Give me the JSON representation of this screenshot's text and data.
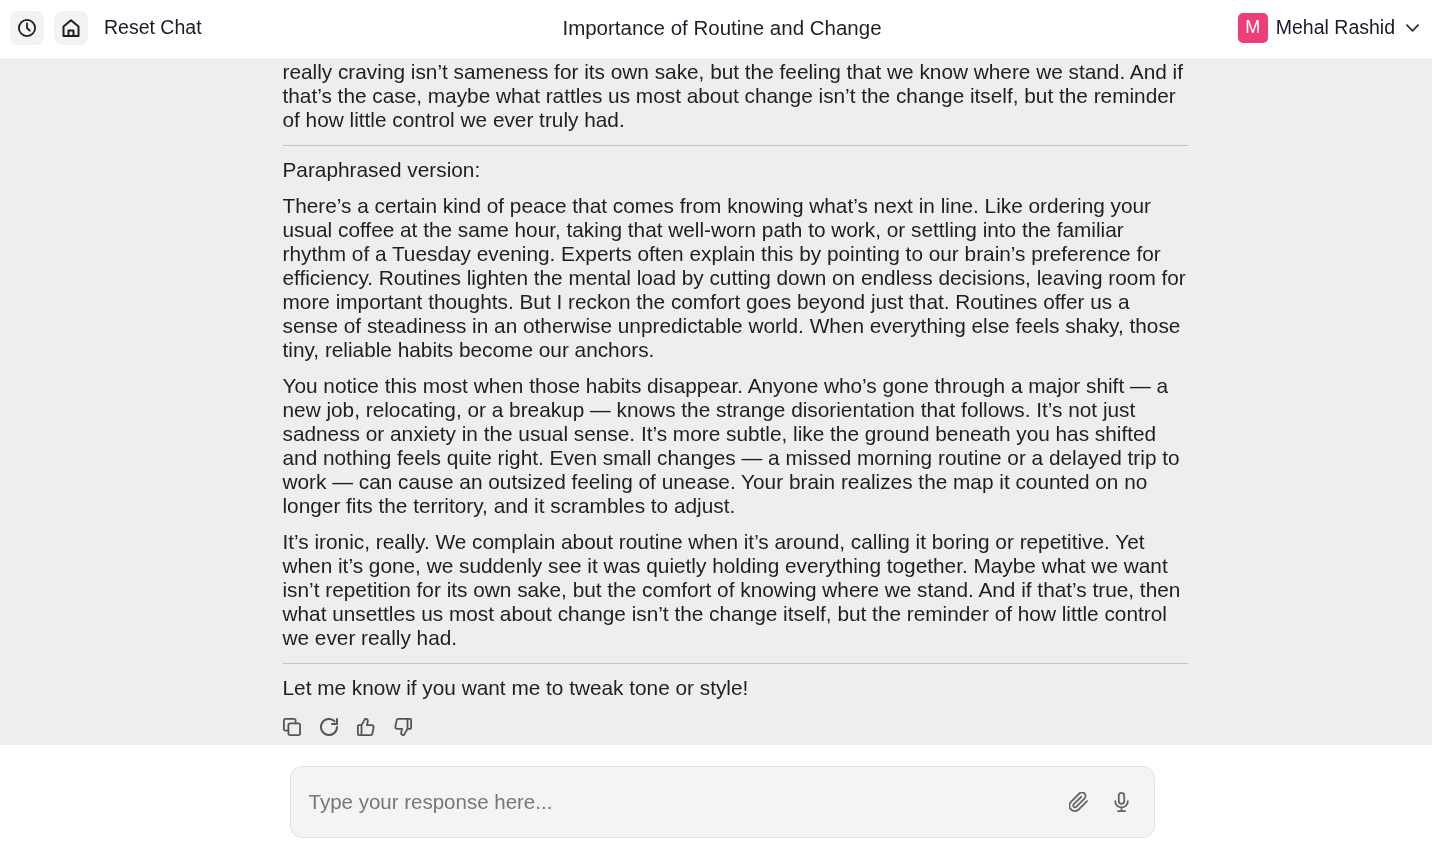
{
  "header": {
    "reset_label": "Reset Chat",
    "title": "Importance of Routine and Change",
    "user": {
      "initial": "M",
      "name": "Mehal Rashid"
    }
  },
  "message": {
    "blocks": [
      {
        "kind": "paragraph",
        "text": "really craving isn’t sameness for its own sake, but the feeling that we know where we stand. And if that’s the case, maybe what rattles us most about change isn’t the change itself, but the reminder of how little control we ever truly had."
      },
      {
        "kind": "divider"
      },
      {
        "kind": "paragraph",
        "text": "Paraphrased version:"
      },
      {
        "kind": "paragraph",
        "text": "There’s a certain kind of peace that comes from knowing what’s next in line. Like ordering your usual coffee at the same hour, taking that well-worn path to work, or settling into the familiar rhythm of a Tuesday evening. Experts often explain this by pointing to our brain’s preference for efficiency. Routines lighten the mental load by cutting down on endless decisions, leaving room for more important thoughts. But I reckon the comfort goes beyond just that. Routines offer us a sense of steadiness in an otherwise unpredictable world. When everything else feels shaky, those tiny, reliable habits become our anchors."
      },
      {
        "kind": "paragraph",
        "text": "You notice this most when those habits disappear. Anyone who’s gone through a major shift — a new job, relocating, or a breakup — knows the strange disorientation that follows. It’s not just sadness or anxiety in the usual sense. It’s more subtle, like the ground beneath you has shifted and nothing feels quite right. Even small changes — a missed morning routine or a delayed trip to work — can cause an outsized feeling of unease. Your brain realizes the map it counted on no longer fits the territory, and it scrambles to adjust."
      },
      {
        "kind": "paragraph",
        "text": "It’s ironic, really. We complain about routine when it’s around, calling it boring or repetitive. Yet when it’s gone, we suddenly see it was quietly holding everything together. Maybe what we want isn’t repetition for its own sake, but the comfort of knowing where we stand. And if that’s true, then what unsettles us most about change isn’t the change itself, but the reminder of how little control we ever really had."
      },
      {
        "kind": "divider"
      },
      {
        "kind": "paragraph",
        "text": "Let me know if you want me to tweak tone or style!"
      }
    ]
  },
  "composer": {
    "placeholder": "Type your response here..."
  }
}
